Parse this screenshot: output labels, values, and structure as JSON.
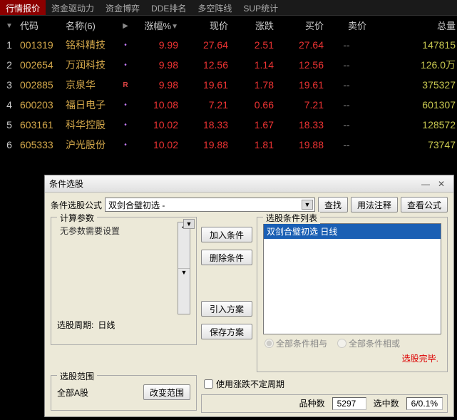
{
  "tabs": {
    "items": [
      "行情报价",
      "资金驱动力",
      "资金博弈",
      "DDE排名",
      "多空阵线",
      "SUP统计"
    ],
    "active": 0
  },
  "table": {
    "headers": {
      "idx": "",
      "code": "代码",
      "name": "名称(6)",
      "flag": "",
      "pct": "涨幅%",
      "price": "现价",
      "chg": "涨跌",
      "bid": "买价",
      "ask": "卖价",
      "vol": "总量"
    },
    "rows": [
      {
        "idx": "1",
        "code": "001319",
        "name": "铭科精技",
        "flag": "dot",
        "pct": "9.99",
        "price": "27.64",
        "chg": "2.51",
        "bid": "27.64",
        "ask": "--",
        "vol": "147815"
      },
      {
        "idx": "2",
        "code": "002654",
        "name": "万润科技",
        "flag": "dot",
        "pct": "9.98",
        "price": "12.56",
        "chg": "1.14",
        "bid": "12.56",
        "ask": "--",
        "vol": "126.0万"
      },
      {
        "idx": "3",
        "code": "002885",
        "name": "京泉华",
        "flag": "R",
        "pct": "9.98",
        "price": "19.61",
        "chg": "1.78",
        "bid": "19.61",
        "ask": "--",
        "vol": "375327"
      },
      {
        "idx": "4",
        "code": "600203",
        "name": "福日电子",
        "flag": "dot",
        "pct": "10.08",
        "price": "7.21",
        "chg": "0.66",
        "bid": "7.21",
        "ask": "--",
        "vol": "601307"
      },
      {
        "idx": "5",
        "code": "603161",
        "name": "科华控股",
        "flag": "dot",
        "pct": "10.02",
        "price": "18.33",
        "chg": "1.67",
        "bid": "18.33",
        "ask": "--",
        "vol": "128572"
      },
      {
        "idx": "6",
        "code": "605333",
        "name": "沪光股份",
        "flag": "dot",
        "pct": "10.02",
        "price": "19.88",
        "chg": "1.81",
        "bid": "19.88",
        "ask": "--",
        "vol": "73747"
      }
    ]
  },
  "dialog": {
    "title": "条件选股",
    "formula_label": "条件选股公式",
    "formula_value": "双剑合璧初选 -",
    "btn_find": "查找",
    "btn_usage": "用法注释",
    "btn_view": "查看公式",
    "params": {
      "legend": "计算参数",
      "text": "无参数需要设置",
      "period_label": "选股周期:",
      "period_value": "日线"
    },
    "mid": {
      "add": "加入条件",
      "del": "删除条件",
      "load": "引入方案",
      "save": "保存方案"
    },
    "list": {
      "legend": "选股条件列表",
      "item": "双剑合璧初选  日线",
      "radio_and": "全部条件相与",
      "radio_or": "全部条件相或",
      "done": "选股完毕."
    },
    "range": {
      "legend": "选股范围",
      "text": "全部A股",
      "btn": "改变范围"
    },
    "bottom": {
      "chk": "使用涨跌不定周期",
      "count_label": "品种数",
      "count_value": "5297",
      "hit_label": "选中数",
      "hit_value": "6/0.1%"
    }
  }
}
